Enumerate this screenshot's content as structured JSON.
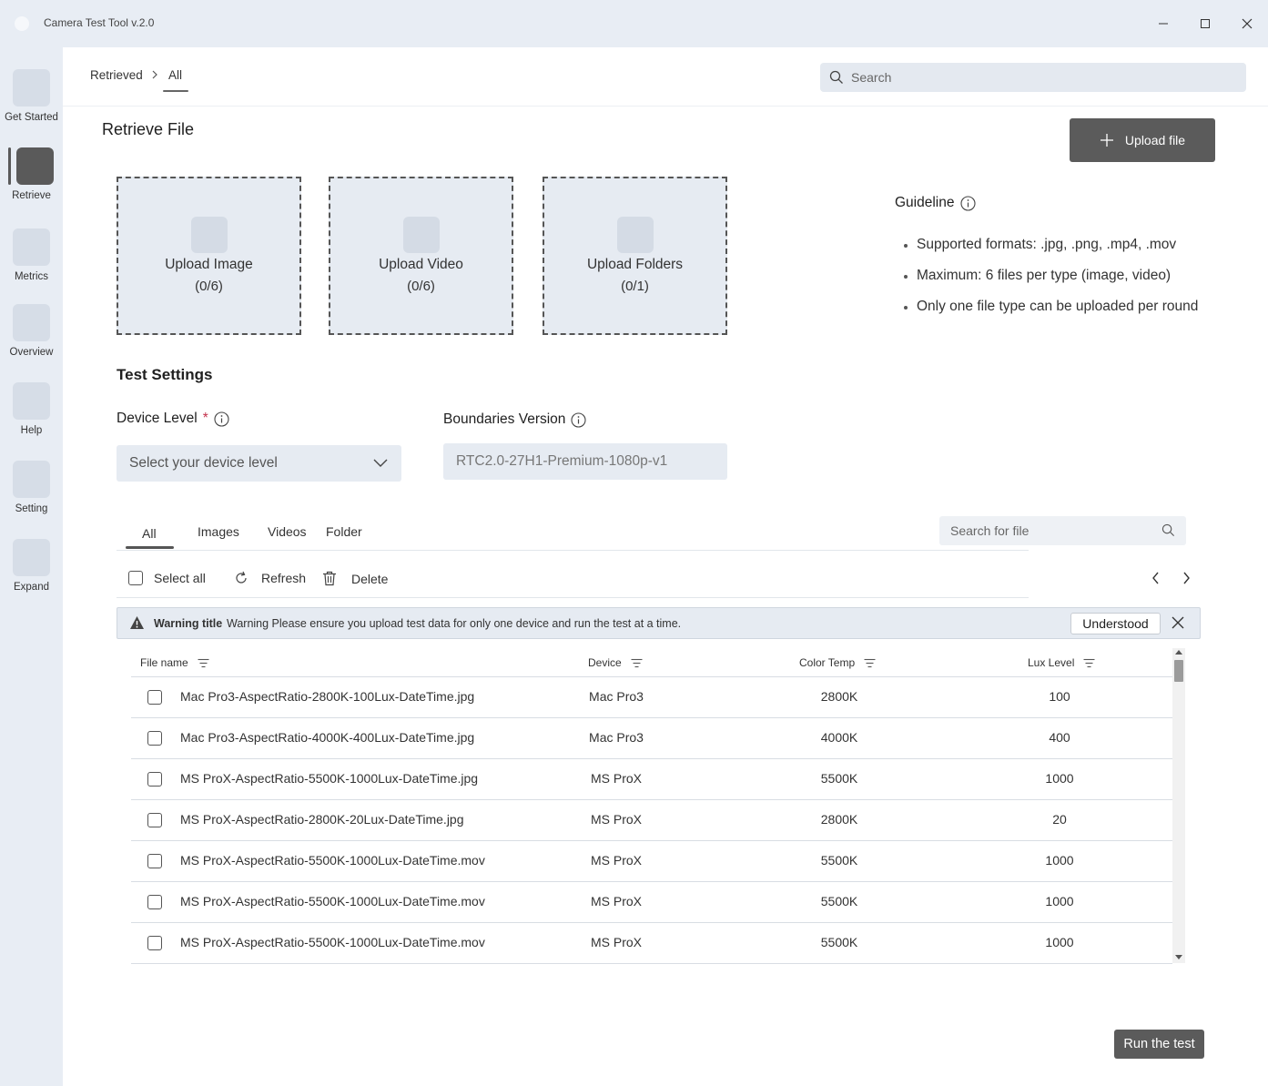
{
  "window": {
    "title": "Camera Test Tool v.2.0",
    "icons": [
      "minimize-icon",
      "maximize-icon",
      "close-icon"
    ]
  },
  "nav": {
    "items": [
      {
        "label": "Get Started"
      },
      {
        "label": "Retrieve",
        "active": true
      },
      {
        "label": "Metrics"
      },
      {
        "label": "Overview"
      },
      {
        "label": "Help"
      },
      {
        "label": "Setting"
      },
      {
        "label": "Expand"
      }
    ]
  },
  "breadcrumb": {
    "parent": "Retrieved",
    "current": "All"
  },
  "search": {
    "placeholder": "Search"
  },
  "retrieve": {
    "title": "Retrieve File",
    "upload_button": "Upload file",
    "dropzones": [
      {
        "label": "Upload Image",
        "count": "(0/6)"
      },
      {
        "label": "Upload Video",
        "count": "(0/6)"
      },
      {
        "label": "Upload Folders",
        "count": "(0/1)"
      }
    ]
  },
  "guideline": {
    "title": "Guideline",
    "items": [
      "Supported formats: .jpg, .png, .mp4, .mov",
      "Maximum: 6 files per type (image, video)",
      "Only one file type can be uploaded per round"
    ]
  },
  "settings": {
    "title": "Test Settings",
    "device_label": "Device Level",
    "required_mark": "*",
    "device_placeholder": "Select your device level",
    "boundaries_label": "Boundaries Version",
    "boundaries_value": "RTC2.0-27H1-Premium-1080p-v1"
  },
  "files": {
    "tabs": [
      "All",
      "Images",
      "Videos",
      "Folder"
    ],
    "active_tab": "All",
    "search_placeholder": "Search for file",
    "toolbar": {
      "select_all": "Select all",
      "refresh": "Refresh",
      "delete": "Delete"
    }
  },
  "warning": {
    "title": "Warning title",
    "message": "Warning  Please ensure you upload test data for only one device and run the test at a time.",
    "action": "Understood"
  },
  "table": {
    "columns": [
      "File name",
      "Device",
      "Color Temp",
      "Lux Level"
    ],
    "rows": [
      {
        "file": "Mac Pro3-AspectRatio-2800K-100Lux-DateTime.jpg",
        "device": "Mac Pro3",
        "temp": "2800K",
        "lux": "100"
      },
      {
        "file": "Mac Pro3-AspectRatio-4000K-400Lux-DateTime.jpg",
        "device": "Mac Pro3",
        "temp": "4000K",
        "lux": "400"
      },
      {
        "file": "MS ProX-AspectRatio-5500K-1000Lux-DateTime.jpg",
        "device": "MS ProX",
        "temp": "5500K",
        "lux": "1000"
      },
      {
        "file": "MS ProX-AspectRatio-2800K-20Lux-DateTime.jpg",
        "device": "MS ProX",
        "temp": "2800K",
        "lux": "20"
      },
      {
        "file": "MS ProX-AspectRatio-5500K-1000Lux-DateTime.mov",
        "device": "MS ProX",
        "temp": "5500K",
        "lux": "1000"
      },
      {
        "file": "MS ProX-AspectRatio-5500K-1000Lux-DateTime.mov",
        "device": "MS ProX",
        "temp": "5500K",
        "lux": "1000"
      },
      {
        "file": "MS ProX-AspectRatio-5500K-1000Lux-DateTime.mov",
        "device": "MS ProX",
        "temp": "5500K",
        "lux": "1000"
      }
    ]
  },
  "run_button": "Run the test",
  "colors": {
    "chrome": "#e8edf4",
    "primary_button": "#5b5b5b",
    "required": "#c4314b"
  }
}
